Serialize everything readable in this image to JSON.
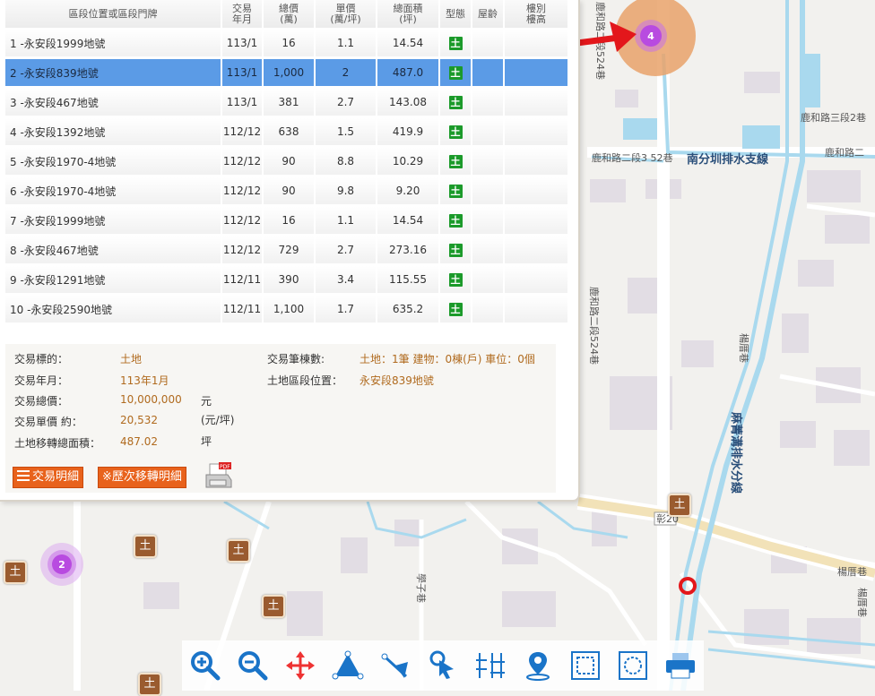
{
  "table": {
    "headers": [
      "區段位置或區段門牌",
      "交易\n年月",
      "總價\n(萬)",
      "單價\n(萬/坪)",
      "總面積\n(坪)",
      "型態",
      "屋齡",
      "樓別\n樓高"
    ],
    "rows": [
      {
        "no": "1",
        "addr": " -永安段1999地號",
        "ym": "113/1",
        "total": "16",
        "unit": "1.1",
        "area": "14.54",
        "type": "土"
      },
      {
        "no": "2",
        "addr": " -永安段839地號",
        "ym": "113/1",
        "total": "1,000",
        "unit": "2",
        "area": "487.0",
        "type": "土"
      },
      {
        "no": "3",
        "addr": " -永安段467地號",
        "ym": "113/1",
        "total": "381",
        "unit": "2.7",
        "area": "143.08",
        "type": "土"
      },
      {
        "no": "4",
        "addr": " -永安段1392地號",
        "ym": "112/12",
        "total": "638",
        "unit": "1.5",
        "area": "419.9",
        "type": "土"
      },
      {
        "no": "5",
        "addr": " -永安段1970-4地號",
        "ym": "112/12",
        "total": "90",
        "unit": "8.8",
        "area": "10.29",
        "type": "土"
      },
      {
        "no": "6",
        "addr": " -永安段1970-4地號",
        "ym": "112/12",
        "total": "90",
        "unit": "9.8",
        "area": "9.20",
        "type": "土"
      },
      {
        "no": "7",
        "addr": " -永安段1999地號",
        "ym": "112/12",
        "total": "16",
        "unit": "1.1",
        "area": "14.54",
        "type": "土"
      },
      {
        "no": "8",
        "addr": " -永安段467地號",
        "ym": "112/12",
        "total": "729",
        "unit": "2.7",
        "area": "273.16",
        "type": "土"
      },
      {
        "no": "9",
        "addr": " -永安段1291地號",
        "ym": "112/11",
        "total": "390",
        "unit": "3.4",
        "area": "115.55",
        "type": "土"
      },
      {
        "no": "10",
        "addr": " -永安段2590地號",
        "ym": "112/11",
        "total": "1,100",
        "unit": "1.7",
        "area": "635.2",
        "type": "土"
      }
    ]
  },
  "detail": {
    "target_label": "交易標的：",
    "target_value": "土地",
    "ym_label": "交易年月：",
    "ym_value": "113年1月",
    "total_label": "交易總價：",
    "total_value": "10,000,000",
    "total_unit": "元",
    "unit_label": "交易單價 約：",
    "unit_value": "20,532",
    "unit_unit": "(元/坪)",
    "area_label": "土地移轉總面積：",
    "area_value": "487.02",
    "area_unit": "坪",
    "count_label": "交易筆棟數:",
    "count_value": "土地：1筆 建物：0棟(戶) 車位：0個",
    "loc_label": "土地區段位置：",
    "loc_value": "永安段839地號",
    "btn_detail": "交易明細",
    "btn_history": "※歷次移轉明細"
  },
  "map": {
    "labels": {
      "l1": "鹿和路二段524巷",
      "l2": "鹿和路三段2巷",
      "l3": "鹿和路二段3 52巷",
      "l4": "鹿和路二",
      "l5": "南分圳排水支線",
      "l6": "鹿和路二段524巷",
      "l7": "楊厝巷",
      "l8": "麻菁溝排水分線",
      "l9": "彰20",
      "l10": "楊厝巷",
      "l11": "楊厝巷",
      "l12": "學子巷"
    },
    "cluster_top_count": "4",
    "cluster_left_count": "2",
    "land_marker_glyph": "土"
  },
  "toolbar": {
    "tools": [
      "zoom-in",
      "zoom-out",
      "pan",
      "measure-area",
      "measure-line",
      "select",
      "grid",
      "location",
      "frame-rect",
      "frame-circle",
      "print"
    ]
  },
  "colors": {
    "selected_row": "#5b9be6",
    "value_text": "#b06a1e",
    "button": "#e8621c",
    "land_icon": "#1b9a2a",
    "marker": "#9a5b2f",
    "cluster": "#b84be0",
    "arrow": "#e3171b",
    "water": "#a9d9ee"
  }
}
